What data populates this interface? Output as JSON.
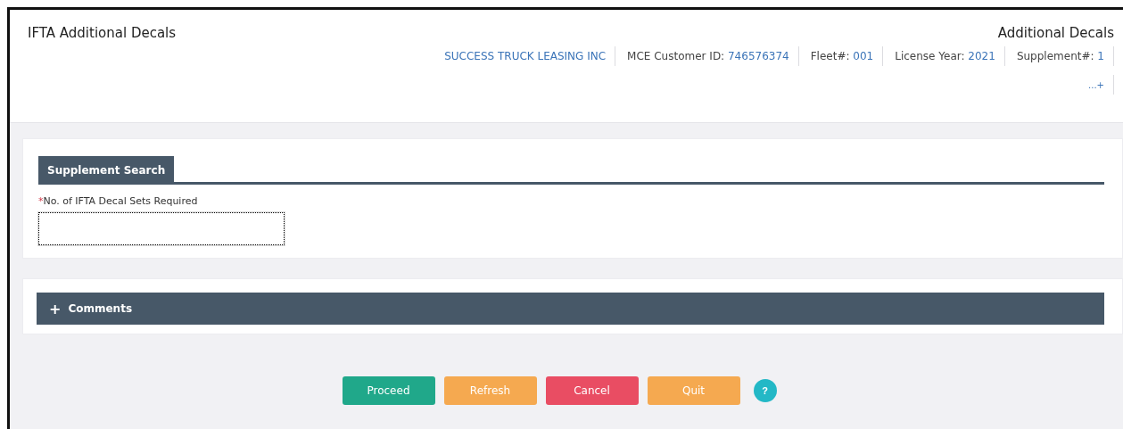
{
  "header": {
    "title": "IFTA Additional Decals",
    "subtitle": "Additional Decals",
    "info": [
      {
        "kind": "value",
        "value": "SUCCESS TRUCK LEASING INC"
      },
      {
        "kind": "pair",
        "label": "MCE Customer ID: ",
        "value": "746576374"
      },
      {
        "kind": "pair",
        "label": "Fleet#: ",
        "value": "001"
      },
      {
        "kind": "pair",
        "label": "License Year: ",
        "value": "2021"
      },
      {
        "kind": "pair",
        "label": "Supplement#: ",
        "value": "1"
      }
    ],
    "more": "...+"
  },
  "search_panel": {
    "tab": "Supplement Search",
    "field": {
      "label": "No. of IFTA Decal Sets Required",
      "required": true,
      "required_mark": "*",
      "focused": true
    }
  },
  "comments_panel": {
    "title": "Comments",
    "expanded": false,
    "toggle": "+"
  },
  "buttons": [
    {
      "label": "Proceed",
      "kind": "primary"
    },
    {
      "label": "Refresh",
      "kind": "warning"
    },
    {
      "label": "Cancel",
      "kind": "danger"
    },
    {
      "label": "Quit",
      "kind": "warning"
    }
  ],
  "help": "?"
}
